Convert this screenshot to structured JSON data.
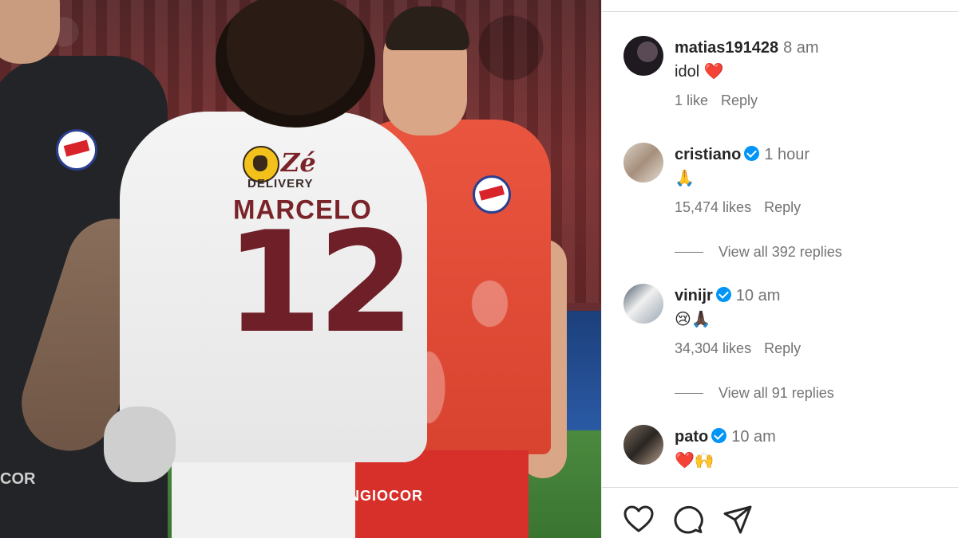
{
  "photo": {
    "sponsor_name": "Zé",
    "sponsor_sub": "DELIVERY",
    "shirt_name": "MARCELO",
    "shirt_number": "12",
    "keeper_shorts_text": "COR",
    "red_shorts_text": "NGIOCOR"
  },
  "comments": [
    {
      "username": "matias191428",
      "verified": false,
      "time": "8 am",
      "text": "idol",
      "emoji": "❤️",
      "likes": "1 like",
      "reply": "Reply"
    },
    {
      "username": "cristiano",
      "verified": true,
      "time": "1 hour",
      "text": "",
      "emoji": "🙏",
      "likes": "15,474 likes",
      "reply": "Reply",
      "view_replies": "View all 392 replies"
    },
    {
      "username": "vinijr",
      "verified": true,
      "time": "10 am",
      "text": "",
      "emoji": "😢🙏🏿",
      "likes": "34,304 likes",
      "reply": "Reply",
      "view_replies": "View all 91 replies"
    },
    {
      "username": "pato",
      "verified": true,
      "time": "10 am",
      "text": "",
      "emoji": "❤️🙌",
      "likes": "",
      "reply": ""
    }
  ],
  "actions": [
    "heart-icon",
    "comment-icon",
    "share-icon"
  ],
  "colors": {
    "verified": "#0095f6",
    "meta": "#737373",
    "text": "#262626"
  }
}
